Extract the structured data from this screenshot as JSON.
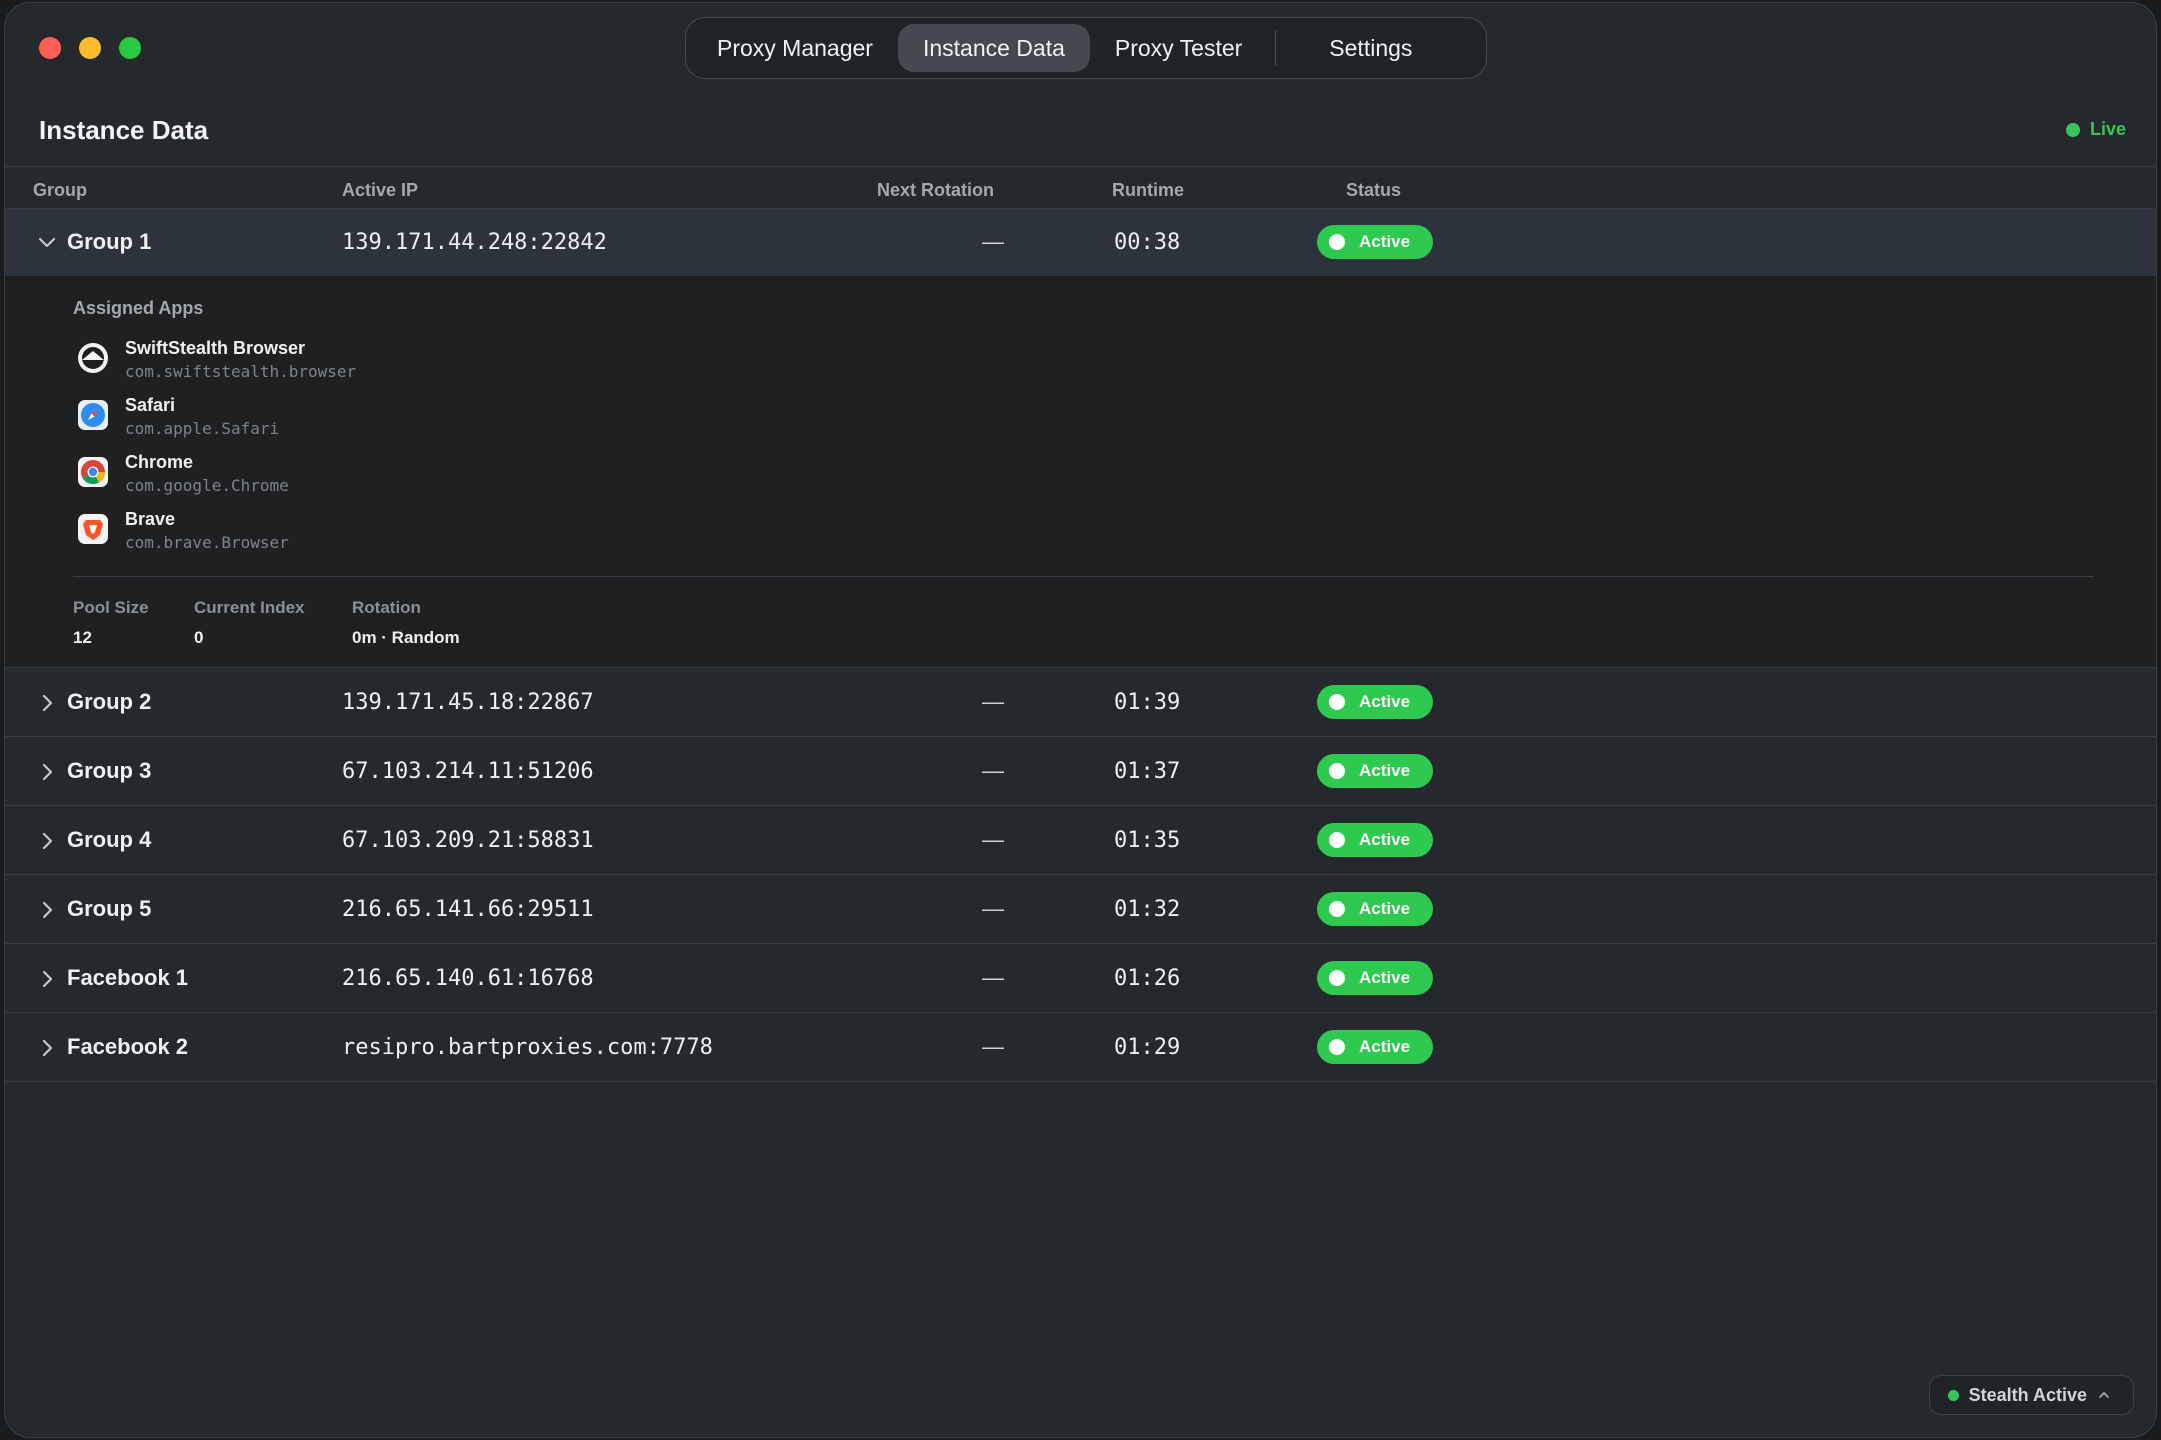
{
  "tabs": [
    {
      "label": "Proxy Manager"
    },
    {
      "label": "Instance Data",
      "selected": true
    },
    {
      "label": "Proxy Tester"
    },
    {
      "label": "Settings"
    }
  ],
  "header": {
    "title": "Instance Data",
    "live_label": "Live",
    "live_color": "#34c759"
  },
  "columns": {
    "group": "Group",
    "active_ip": "Active IP",
    "next_rotation": "Next Rotation",
    "runtime": "Runtime",
    "status": "Status"
  },
  "rows": [
    {
      "group": "Group 1",
      "ip": "139.171.44.248:22842",
      "next": "—",
      "runtime": "00:38",
      "status": "Active",
      "expanded": true
    },
    {
      "group": "Group 2",
      "ip": "139.171.45.18:22867",
      "next": "—",
      "runtime": "01:39",
      "status": "Active"
    },
    {
      "group": "Group 3",
      "ip": "67.103.214.11:51206",
      "next": "—",
      "runtime": "01:37",
      "status": "Active"
    },
    {
      "group": "Group 4",
      "ip": "67.103.209.21:58831",
      "next": "—",
      "runtime": "01:35",
      "status": "Active"
    },
    {
      "group": "Group 5",
      "ip": "216.65.141.66:29511",
      "next": "—",
      "runtime": "01:32",
      "status": "Active"
    },
    {
      "group": "Facebook 1",
      "ip": "216.65.140.61:16768",
      "next": "—",
      "runtime": "01:26",
      "status": "Active"
    },
    {
      "group": "Facebook 2",
      "ip": "resipro.bartproxies.com:7778",
      "next": "—",
      "runtime": "01:29",
      "status": "Active"
    }
  ],
  "expanded_panel": {
    "assigned_apps_label": "Assigned Apps",
    "apps": [
      {
        "name": "SwiftStealth Browser",
        "bundle": "com.swiftstealth.browser",
        "icon": "swiftstealth-icon"
      },
      {
        "name": "Safari",
        "bundle": "com.apple.Safari",
        "icon": "safari-icon"
      },
      {
        "name": "Chrome",
        "bundle": "com.google.Chrome",
        "icon": "chrome-icon"
      },
      {
        "name": "Brave",
        "bundle": "com.brave.Browser",
        "icon": "brave-icon"
      }
    ],
    "stats": {
      "pool_size_label": "Pool Size",
      "pool_size": "12",
      "current_index_label": "Current Index",
      "current_index": "0",
      "rotation_label": "Rotation",
      "rotation": "0m · Random"
    }
  },
  "footer": {
    "stealth_label": "Stealth Active"
  },
  "colors": {
    "status_active": "#2ec94f",
    "accent_green": "#34c759"
  }
}
